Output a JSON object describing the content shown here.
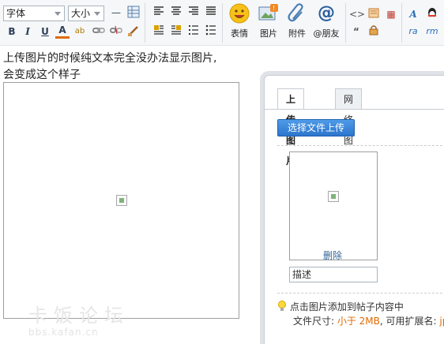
{
  "toolbar": {
    "font_select": "字体",
    "size_select": "大小",
    "big_buttons": [
      {
        "label": "表情",
        "icon": "smiley-icon"
      },
      {
        "label": "图片",
        "icon": "image-icon"
      },
      {
        "label": "附件",
        "icon": "paperclip-icon"
      },
      {
        "label": "@朋友",
        "icon": "at-sign-icon"
      }
    ],
    "format_row1": [
      "hr-icon",
      "table-icon",
      "align-left-icon",
      "align-center-icon",
      "align-right-icon",
      "align-justify-icon"
    ],
    "format_row2": [
      "bold-icon",
      "italic-icon",
      "underline-icon",
      "font-color-icon",
      "spellcheck-icon",
      "link-icon",
      "unlink-icon",
      "clear-format-icon",
      "float-left-icon",
      "float-right-icon",
      "ordered-list-icon",
      "unordered-list-icon"
    ],
    "extra_icons": [
      "code-icon",
      "hide-content-icon",
      "quote-icon",
      "free-content-icon",
      "font-style-icon",
      "qq-icon",
      "qq-scene-icon",
      "qq-show-icon"
    ]
  },
  "message": {
    "line1": "上传图片的时候纯文本完全没办法显示图片,",
    "line2": "会变成这个样子"
  },
  "watermark": {
    "line1": "卡饭论坛",
    "line2": "bbs.kafan.cn"
  },
  "upload_panel": {
    "tabs": [
      "上传图片",
      "网络图片"
    ],
    "active_tab": "上传图片",
    "upload_button": "选择文件上传",
    "delete_label": "删除",
    "description_value": "描述",
    "tip_text": "点击图片添加到帖子内容中",
    "filesize_label": "文件尺寸: ",
    "filesize_value": "小于 2MB",
    "ext_label": ", 可用扩展名: ",
    "ext_value": "jp"
  },
  "colors": {
    "accent_blue": "#2c75cc",
    "highlight_orange": "#e06a00",
    "link_blue": "#336699",
    "panel_border": "#c9cdd2"
  }
}
